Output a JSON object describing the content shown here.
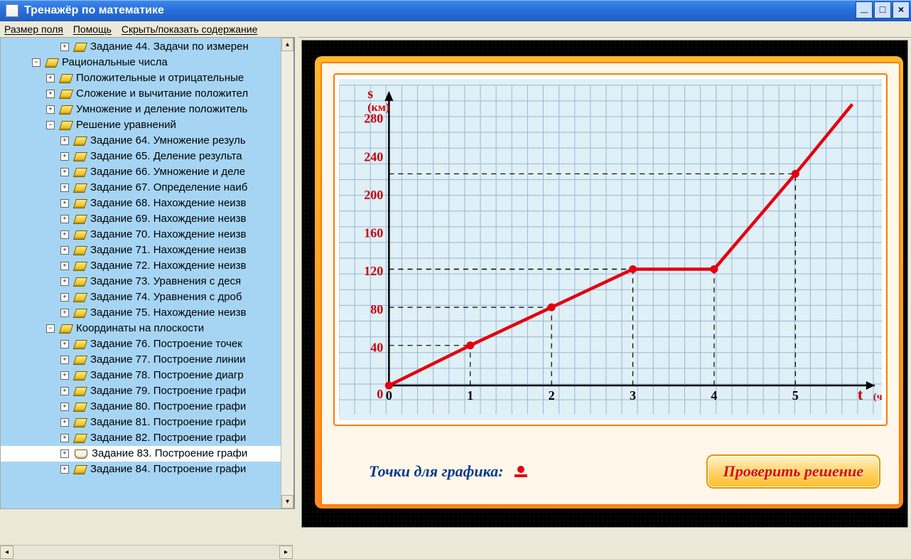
{
  "window": {
    "title": "Тренажёр по математике"
  },
  "menu": {
    "size": "Размер поля",
    "help": "Помощь",
    "toggle": "Скрыть/показать содержание"
  },
  "tree": {
    "n44": "Задание 44. Задачи по измерен",
    "nRat": "Рациональные числа",
    "nPos": "Положительные и отрицательные",
    "nAdd": "Сложение и вычитание положител",
    "nMul": "Умножение и деление положитель",
    "nEq": "Решение уравнений",
    "n64": "Задание 64. Умножение резуль",
    "n65": "Задание 65. Деление результа",
    "n66": "Задание 66. Умножение и деле",
    "n67": "Задание 67. Определение наиб",
    "n68": "Задание 68. Нахождение неизв",
    "n69": "Задание 69. Нахождение неизв",
    "n70": "Задание 70. Нахождение неизв",
    "n71": "Задание 71. Нахождение неизв",
    "n72": "Задание 72. Нахождение неизв",
    "n73": "Задание 73. Уравнения с деся",
    "n74": "Задание 74. Уравнения с дроб",
    "n75": "Задание 75. Нахождение неизв",
    "nCoord": "Координаты на плоскости",
    "n76": "Задание 76. Построение точек",
    "n77": "Задание 77. Построение линии",
    "n78": "Задание 78. Построение диагр",
    "n79": "Задание 79. Построение графи",
    "n80": "Задание 80. Построение графи",
    "n81": "Задание 81. Построение графи",
    "n82": "Задание 82. Построение графи",
    "n83": "Задание 83. Построение графи",
    "n84": "Задание 84. Построение графи"
  },
  "task": {
    "points_label": "Точки для графика:",
    "check_label": "Проверить решение"
  },
  "chart_data": {
    "type": "line",
    "xlabel": "t",
    "xunit": "(ч)",
    "ylabel": "s",
    "yunit": "(км)",
    "xlim": [
      0,
      5.8
    ],
    "ylim": [
      0,
      300
    ],
    "xticks": [
      0,
      1,
      2,
      3,
      4,
      5
    ],
    "yticks": [
      40,
      80,
      120,
      160,
      200,
      240,
      280
    ],
    "points": [
      {
        "x": 0,
        "y": 0
      },
      {
        "x": 1,
        "y": 42
      },
      {
        "x": 2,
        "y": 82
      },
      {
        "x": 3,
        "y": 122
      },
      {
        "x": 4,
        "y": 122
      },
      {
        "x": 5,
        "y": 222
      },
      {
        "x": 5.7,
        "y": 295
      }
    ],
    "marked_points": [
      0,
      1,
      2,
      3,
      4,
      5
    ],
    "guide_lines": [
      {
        "x": 1,
        "y": 42
      },
      {
        "x": 2,
        "y": 82
      },
      {
        "x": 3,
        "y": 122
      },
      {
        "x": 4,
        "y": 122
      },
      {
        "x": 5,
        "y": 222
      }
    ]
  }
}
